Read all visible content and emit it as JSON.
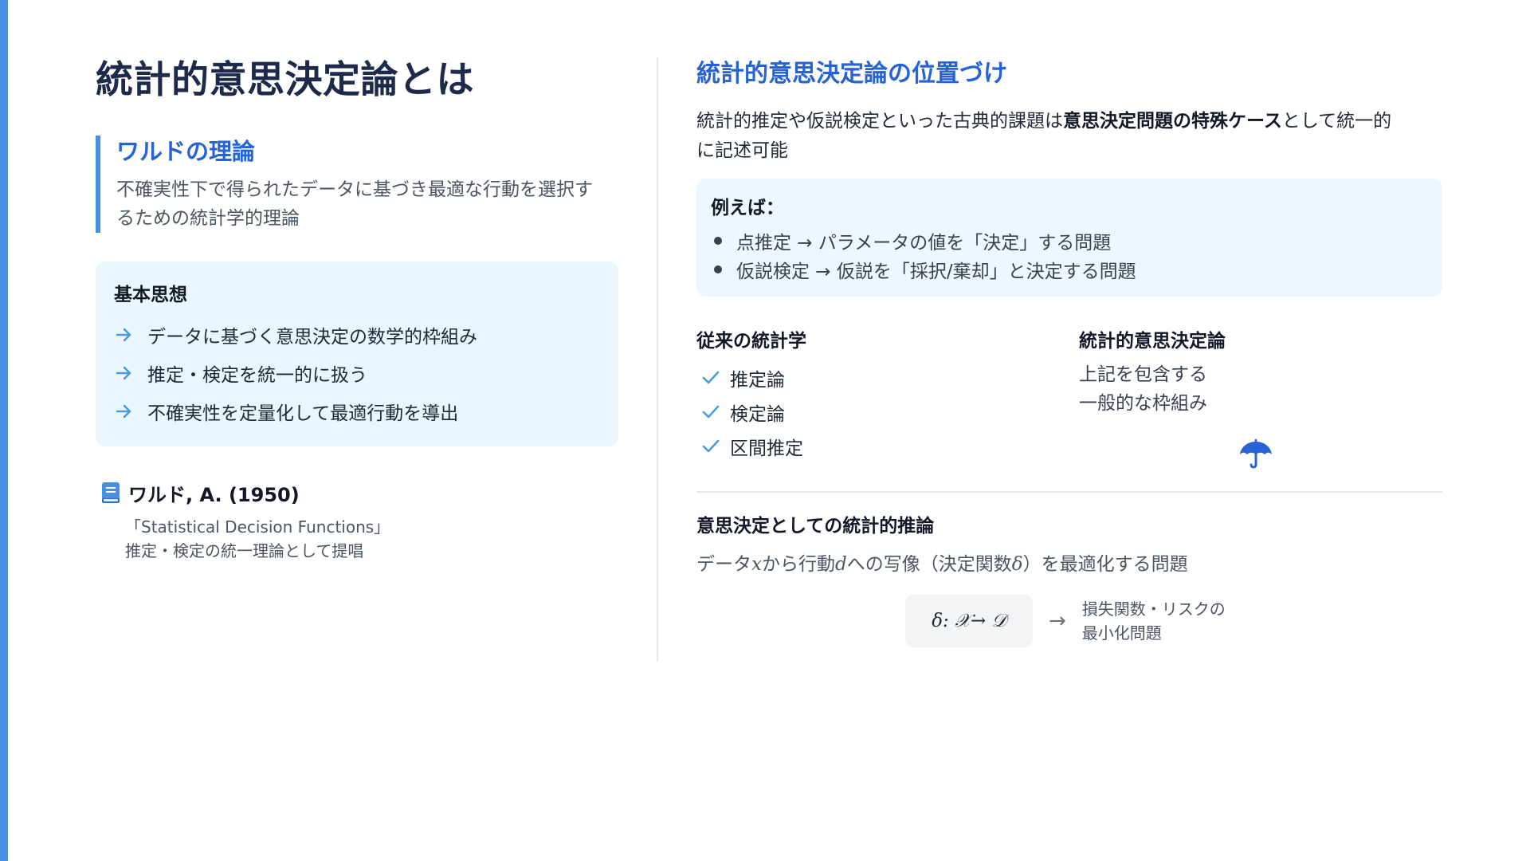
{
  "theme": {
    "accent": "#4a90e2",
    "title_blue": "#2563d6",
    "heading_dark": "#1e2a4a",
    "card_light_blue": "#eaf6fd",
    "card_pale_blue": "#eff6ff",
    "formula_bg": "#f3f4f6"
  },
  "left": {
    "title": "統計的意思決定論とは",
    "wald": {
      "title": "ワルドの理論",
      "desc_line1": "不確実性下で得られたデータに基づき最適な行動を選択す",
      "desc_line2": "るための統計学的理論"
    },
    "basic": {
      "title": "基本思想",
      "icon": "arrow-right-icon",
      "items": [
        "データに基づく意思決定の数学的枠組み",
        "推定・検定を統一的に扱う",
        "不確実性を定量化して最適行動を導出"
      ]
    },
    "reference": {
      "icon": "book-icon",
      "name": "ワルド, A. (1950)",
      "line1": "「Statistical Decision Functions」",
      "line2": "推定・検定の統一理論として提唱"
    }
  },
  "right": {
    "title": "統計的意思決定論の位置づけ",
    "intro": {
      "before": "統計的推定や仮説検定といった古典的課題は",
      "bold": "意思決定問題の特殊ケース",
      "after": "として統一的",
      "line2": "に記述可能"
    },
    "example": {
      "title": "例えば：",
      "items": [
        "点推定 → パラメータの値を「決定」する問題",
        "仮説検定 → 仮説を「採択/棄却」と決定する問題"
      ]
    },
    "traditional": {
      "title": "従来の統計学",
      "icon": "check-icon",
      "items": [
        "推定論",
        "検定論",
        "区間推定"
      ]
    },
    "decision_theory": {
      "title": "統計的意思決定論",
      "line1": "上記を包含する",
      "line2": "一般的な枠組み",
      "icon": "umbrella-icon"
    },
    "inference": {
      "title": "意思決定としての統計的推論",
      "desc_p1": "データ",
      "desc_x": "x",
      "desc_p2": "から行動",
      "desc_d": "d",
      "desc_p3": "への写像（決定関数",
      "desc_delta": "δ",
      "desc_p4": "）を最適化する問題",
      "formula": "δ: 𝒳→ 𝒟",
      "arrow": "→",
      "note_line1": "損失関数・リスクの",
      "note_line2": "最小化問題"
    }
  }
}
